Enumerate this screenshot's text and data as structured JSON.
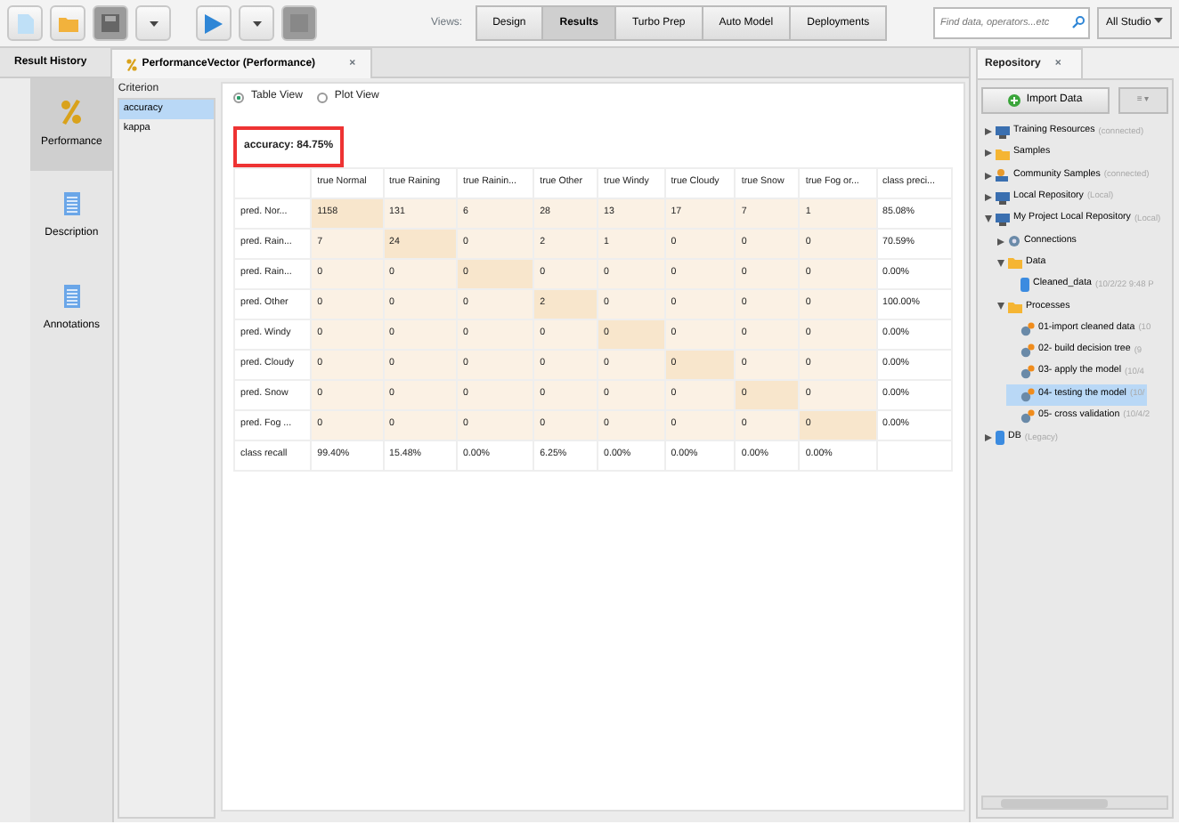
{
  "toolbar": {
    "views_label": "Views:",
    "views": [
      {
        "label": "Design",
        "selected": false
      },
      {
        "label": "Results",
        "selected": true
      },
      {
        "label": "Turbo Prep",
        "selected": false
      },
      {
        "label": "Auto Model",
        "selected": false
      },
      {
        "label": "Deployments",
        "selected": false
      }
    ],
    "search": {
      "placeholder": "Find data, operators...etc"
    },
    "studio": "All Studio"
  },
  "left_tabs": [
    {
      "label": "Result History",
      "selected": false
    },
    {
      "label": "PerformanceVector (Performance)",
      "selected": true,
      "close": "×"
    }
  ],
  "side_nav": [
    {
      "label": "Performance",
      "kind": "percent",
      "selected": true
    },
    {
      "label": "Description",
      "kind": "doc",
      "selected": false
    },
    {
      "label": "Annotations",
      "kind": "doc",
      "selected": false
    }
  ],
  "criterion": {
    "title": "Criterion",
    "items": [
      {
        "label": "accuracy",
        "selected": true
      },
      {
        "label": "kappa",
        "selected": false
      }
    ]
  },
  "view_options": [
    {
      "label": "Table View",
      "selected": true
    },
    {
      "label": "Plot View",
      "selected": false
    }
  ],
  "result_label": "accuracy: 84.75%",
  "table": {
    "columns": [
      "true Normal",
      "true Raining",
      "true Rainin...",
      "true Other",
      "true Windy",
      "true Cloudy",
      "true Snow",
      "true Fog or...",
      "class preci..."
    ],
    "rows": [
      {
        "label": "pred. Nor...",
        "cells": [
          "1158",
          "131",
          "6",
          "28",
          "13",
          "17",
          "7",
          "1",
          "85.08%"
        ]
      },
      {
        "label": "pred. Rain...",
        "cells": [
          "7",
          "24",
          "0",
          "2",
          "1",
          "0",
          "0",
          "0",
          "70.59%"
        ]
      },
      {
        "label": "pred. Rain...",
        "cells": [
          "0",
          "0",
          "0",
          "0",
          "0",
          "0",
          "0",
          "0",
          "0.00%"
        ]
      },
      {
        "label": "pred. Other",
        "cells": [
          "0",
          "0",
          "0",
          "2",
          "0",
          "0",
          "0",
          "0",
          "100.00%"
        ]
      },
      {
        "label": "pred. Windy",
        "cells": [
          "0",
          "0",
          "0",
          "0",
          "0",
          "0",
          "0",
          "0",
          "0.00%"
        ]
      },
      {
        "label": "pred. Cloudy",
        "cells": [
          "0",
          "0",
          "0",
          "0",
          "0",
          "0",
          "0",
          "0",
          "0.00%"
        ]
      },
      {
        "label": "pred. Snow",
        "cells": [
          "0",
          "0",
          "0",
          "0",
          "0",
          "0",
          "0",
          "0",
          "0.00%"
        ]
      },
      {
        "label": "pred. Fog ...",
        "cells": [
          "0",
          "0",
          "0",
          "0",
          "0",
          "0",
          "0",
          "0",
          "0.00%"
        ]
      }
    ],
    "footer": {
      "label": "class recall",
      "cells": [
        "99.40%",
        "15.48%",
        "0.00%",
        "6.25%",
        "0.00%",
        "0.00%",
        "0.00%",
        "0.00%"
      ]
    }
  },
  "repository": {
    "tab": {
      "label": "Repository",
      "close": "×"
    },
    "import_button": "Import Data",
    "menu_button": "≡ ▾",
    "tree": [
      {
        "label": "Training Resources",
        "note": "(connected)",
        "kind": "monitor",
        "expanded": false,
        "selected": false
      },
      {
        "label": "Samples",
        "kind": "folder",
        "expanded": false,
        "selected": false
      },
      {
        "label": "Community Samples",
        "note": "(connected)",
        "kind": "people",
        "expanded": false,
        "selected": false
      },
      {
        "label": "Local Repository",
        "note": "(Local)",
        "kind": "monitor",
        "expanded": false,
        "selected": false
      },
      {
        "label": "My Project Local Repository",
        "note": "(Local)",
        "kind": "monitor",
        "expanded": true,
        "selected": false,
        "children": [
          {
            "label": "Connections",
            "kind": "gear",
            "expanded": false,
            "selected": false
          },
          {
            "label": "Data",
            "kind": "folder",
            "expanded": true,
            "selected": false,
            "children": [
              {
                "label": "Cleaned_data",
                "note": "(10/2/22 9:48 P",
                "kind": "db",
                "selected": false
              }
            ]
          },
          {
            "label": "Processes",
            "kind": "folder",
            "expanded": true,
            "selected": false,
            "children": [
              {
                "label": "01-import cleaned data",
                "note": "(10",
                "kind": "process",
                "selected": false
              },
              {
                "label": "02- build decision tree",
                "note": "(9",
                "kind": "process",
                "selected": false
              },
              {
                "label": "03- apply the model",
                "note": "(10/4",
                "kind": "process",
                "selected": false
              },
              {
                "label": "04- testing the model",
                "note": "(10/",
                "kind": "process",
                "selected": true
              },
              {
                "label": "05- cross validation",
                "note": "(10/4/2",
                "kind": "process",
                "selected": false
              }
            ]
          }
        ]
      },
      {
        "label": "DB",
        "note": "(Legacy)",
        "kind": "db",
        "expanded": false,
        "selected": false
      }
    ]
  }
}
